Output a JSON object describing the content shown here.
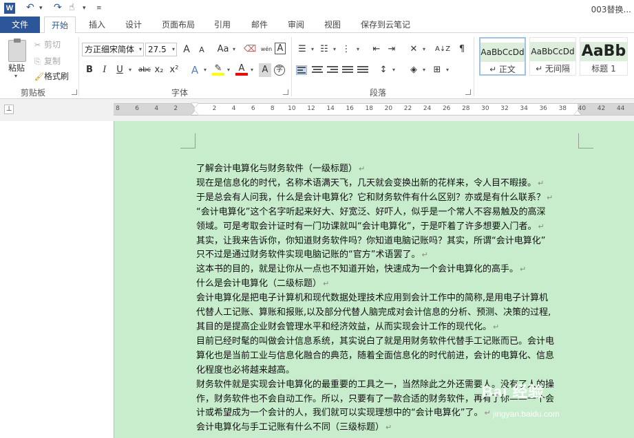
{
  "titlebar": {
    "app_icon": "W",
    "doc_title": "003替换..."
  },
  "tabs": {
    "file": "文件",
    "items": [
      "开始",
      "插入",
      "设计",
      "页面布局",
      "引用",
      "邮件",
      "审阅",
      "视图",
      "保存到云笔记"
    ],
    "active": "开始"
  },
  "clipboard": {
    "paste": "粘贴",
    "cut": "剪切",
    "copy": "复制",
    "format_painter": "格式刷",
    "group_label": "剪贴板"
  },
  "font": {
    "name": "方正细宋简体",
    "size": "27.5",
    "group_label": "字体",
    "grow": "A",
    "shrink": "A",
    "case": "Aa",
    "wen": "wén",
    "bold": "B",
    "italic": "I",
    "underline": "U",
    "strike": "abc",
    "sub": "x₂",
    "sup": "x²",
    "effects": "A",
    "color_a": "A",
    "char_a": "A",
    "enclose": "字",
    "border_a": "A"
  },
  "paragraph": {
    "group_label": "段落",
    "sort": "A↓Z"
  },
  "styles": {
    "items": [
      {
        "sample": "AaBbCcDd",
        "name": "↵ 正文"
      },
      {
        "sample": "AaBbCcDd",
        "name": "↵ 无间隔"
      },
      {
        "sample": "AaBb",
        "name": "标题 1"
      }
    ]
  },
  "ruler": {
    "ticks": [
      "8",
      "6",
      "4",
      "2",
      "",
      "2",
      "4",
      "6",
      "8",
      "10",
      "12",
      "14",
      "16",
      "18",
      "20",
      "22",
      "24",
      "26",
      "28",
      "30",
      "32",
      "34",
      "36",
      "38",
      "40",
      "42",
      "44"
    ],
    "tab_selector": "⊥"
  },
  "document": {
    "paragraph_mark": "↵",
    "lines": [
      "了解会计电算化与财务软件（一级标题）",
      "现在是信息化的时代，名称术语满天飞，几天就会变换出新的花样来，令人目不暇接。",
      "于是总会有人问我，什么是会计电算化？它和财务软件有什么区别？亦或是有什么联系？",
      "“会计电算化”这个名字听起来好大、好宽泛、好吓人，似乎是一个常人不容易触及的高深",
      "领域。可是考取会计证时有一门功课就叫“会计电算化”，于是吓着了许多想要入门者。",
      "其实，让我来告诉你，你知道财务软件吗？你知道电脑记账吗？其实，所谓“会计电算化”",
      "只不过是通过财务软件实现电脑记账的“官方”术语罢了。",
      "这本书的目的，就是让你从一点也不知道开始，快速成为一个会计电算化的高手。",
      "什么是会计电算化（二级标题）",
      "会计电算化是把电子计算机和现代数据处理技术应用到会计工作中的简称,是用电子计算机",
      "代替人工记账、算账和报账,以及部分代替人脑完成对会计信息的分析、预测、决策的过程,",
      "其目的是提高企业财会管理水平和经济效益，从而实现会计工作的现代化。",
      "目前已经时髦的叫做会计信息系统，其实说白了就是用财务软件代替手工记账而已。会计电",
      "算化也是当前工业与信息化融合的典范，随着全面信息化的时代前进，会计的电算化、信息",
      "化程度也必将越来越高。",
      "财务软件就是实现会计电算化的最重要的工具之一，当然除此之外还需要人。没有了人的操",
      "作，财务软件也不会自动工作。所以，只要有了一款合适的财务软件，再有了你——一个会",
      "计或希望成为一个会计的人，我们就可以实现理想中的“会计电算化”了。",
      "会计电算化与手工记账有什么不同（三级标题）"
    ],
    "line_marks": [
      true,
      true,
      true,
      false,
      true,
      false,
      true,
      true,
      true,
      false,
      false,
      true,
      false,
      false,
      false,
      false,
      false,
      true,
      true
    ]
  },
  "watermark": {
    "main": "Bai 经验",
    "sub": "jingyan.baidu.com"
  },
  "colors": {
    "accent": "#2b579a",
    "page_bg": "#c7edcc"
  }
}
